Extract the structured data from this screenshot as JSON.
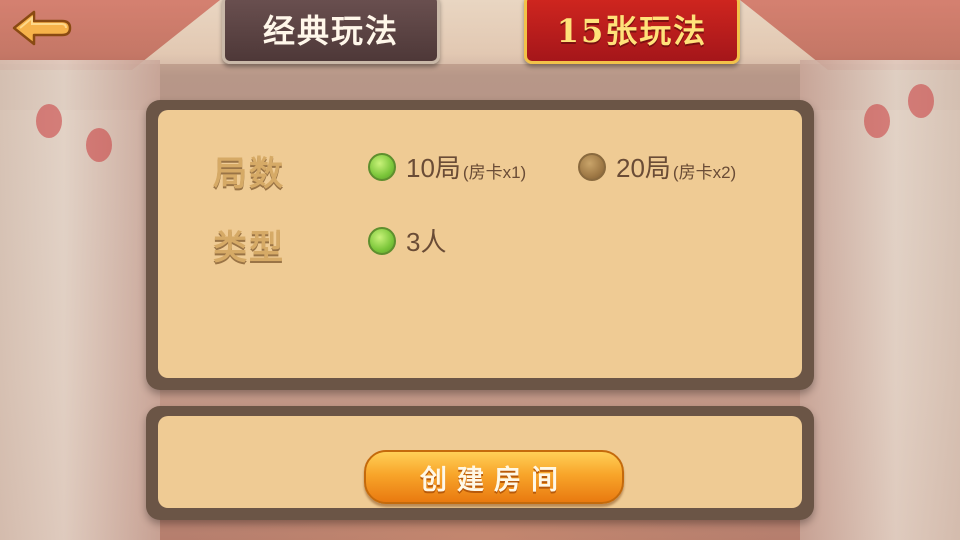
{
  "header": {
    "back_icon": "back-arrow-icon",
    "tabs": [
      {
        "label": "经典玩法",
        "selected": false
      },
      {
        "label": "15张玩法",
        "selected": true
      }
    ]
  },
  "options": {
    "rounds": {
      "label": "局数",
      "choices": [
        {
          "main": "10局",
          "sub": "(房卡x1)",
          "selected": true
        },
        {
          "main": "20局",
          "sub": "(房卡x2)",
          "selected": false
        }
      ]
    },
    "type": {
      "label": "类型",
      "choices": [
        {
          "main": "3人",
          "selected": true
        }
      ]
    }
  },
  "create": {
    "button_label": "创建房间"
  },
  "colors": {
    "selected_radio": "#7bc63a",
    "unselected_radio": "#a07a46",
    "panel_bg": "#efcb94",
    "active_tab": "#c41e1a"
  }
}
